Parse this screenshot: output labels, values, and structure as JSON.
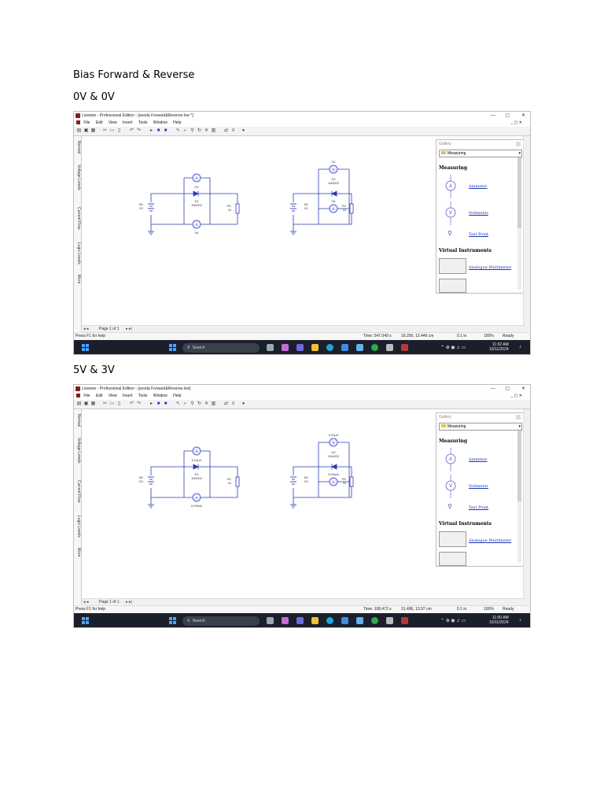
{
  "doc": {
    "heading": "Bias Forward & Reverse",
    "shots": [
      {
        "caption": "0V & 0V",
        "title": "Livewire - Professional Edition - [anoda Forward&Reverse.lvw *]",
        "menu": [
          "File",
          "Edit",
          "View",
          "Insert",
          "Tools",
          "Window",
          "Help"
        ],
        "side_tabs": [
          "Normal",
          "Voltage Levels",
          "Current Flow",
          "Logic Levels",
          "More"
        ],
        "circuit": {
          "d1_top_meter": "0V",
          "d1_label": "D1",
          "d1_part": "1N4002",
          "d1_bottom_meter": "0A",
          "b1_label": "B1",
          "b1_value": "0V",
          "r1_label": "R1",
          "r1_value": "1k",
          "d2_top_meter": "0V",
          "d2_label": "D2",
          "d2_part": "1N4002",
          "d2_bottom_meter": "0A",
          "b2_label": "B2",
          "b2_value": "0V",
          "r2_label": "R2",
          "r2_value": "1k"
        },
        "gallery": {
          "title": "Gallery",
          "dropdown": "Measuring",
          "section1": "Measuring",
          "items": [
            "Ammeter",
            "Voltmeter",
            "Test Point"
          ],
          "section2": "Virtual Instruments",
          "instrument": "Analogue Multimeter"
        },
        "page": "Page 1 of 1",
        "status": {
          "help": "Press F1 for help",
          "time": "Time: 547.049 s",
          "coords": "16.256, 12.446 cm",
          "grid": "0.1 in",
          "zoom": "100%",
          "state": "Ready"
        },
        "taskbar": {
          "search": "Search",
          "time": "11:02 AM",
          "date": "10/11/2024"
        }
      },
      {
        "caption": "5V & 3V",
        "title": "Livewire - Professional Edition - [anoda Forward&Reverse.lvw]",
        "menu": [
          "File",
          "Edit",
          "View",
          "Insert",
          "Tools",
          "Window",
          "Help"
        ],
        "side_tabs": [
          "Normal",
          "Voltage Levels",
          "Current Flow",
          "Logic Levels",
          "More"
        ],
        "circuit": {
          "d1_top_meter": "5.01µV",
          "d1_label": "D1",
          "d1_part": "1N4002",
          "d1_bottom_meter": "5.00mA",
          "b1_label": "B1",
          "b1_value": "5V",
          "r1_label": "R1",
          "r1_value": "1k",
          "d2_top_meter": "3.01µV",
          "d2_label": "D2",
          "d2_part": "1N4002",
          "d2_bottom_meter": "3.00mA",
          "b2_label": "B2",
          "b2_value": "3V",
          "r2_label": "R2",
          "r2_value": "1k"
        },
        "gallery": {
          "title": "Gallery",
          "dropdown": "Measuring",
          "section1": "Measuring",
          "items": [
            "Ammeter",
            "Voltmeter",
            "Test Point"
          ],
          "section2": "Virtual Instruments",
          "instrument": "Analogue Multimeter"
        },
        "page": "Page 1 of 1",
        "status": {
          "help": "Press F1 for help",
          "time": "Time: 108.472 s",
          "coords": "31.496, 13.97 cm",
          "grid": "0.1 in",
          "zoom": "100%",
          "state": "Ready"
        },
        "taskbar": {
          "search": "Search",
          "time": "11:00 AM",
          "date": "10/11/2024"
        }
      }
    ]
  },
  "colors": {
    "wire": "#2a3bb0",
    "meter": "#5a5fcf",
    "link": "#1a33b8",
    "taskbar": "#1b1f2b"
  }
}
